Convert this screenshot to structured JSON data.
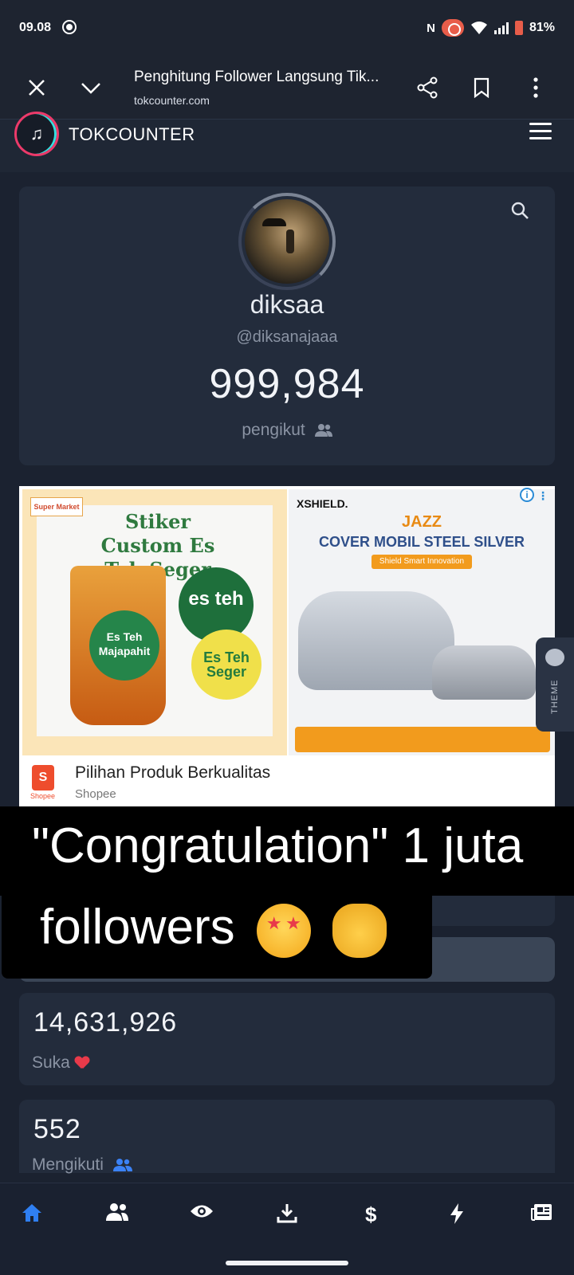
{
  "status_bar": {
    "time": "09.08",
    "battery": "81%",
    "nfc": "N"
  },
  "browser": {
    "title": "Penghitung Follower Langsung Tik...",
    "url": "tokcounter.com"
  },
  "site": {
    "name": "TOKCOUNTER"
  },
  "profile": {
    "display_name": "diksaa",
    "username": "@diksanajaaa",
    "followers": "999,984",
    "followers_label": "pengikut"
  },
  "ad": {
    "left": {
      "store_tag": "Super Market",
      "title": "Stiker Custom Es Teh Seger",
      "badge_1": "Es Teh Majapahit",
      "badge_2": "es teh",
      "badge_3": "Es Teh Seger"
    },
    "right": {
      "brand": "XSHIELD.",
      "model": "JAZZ",
      "headline": "COVER MOBIL STEEL SILVER",
      "tagline": "Shield Smart Innovation"
    },
    "headline": "Pilihan Produk Berkualitas",
    "source": "Shopee",
    "shopee_small": "Shopee",
    "info_glyph": "i",
    "menu_glyph": "⋮"
  },
  "theme_tab": {
    "label": "THEME"
  },
  "overlay": {
    "line1": "\"Congratulation\" 1 juta",
    "line2": "followers"
  },
  "stats": {
    "likes_value": "14,631,926",
    "likes_label": "Suka",
    "following_value": "552",
    "following_label": "Mengikuti"
  },
  "bottom_nav": {
    "items": [
      "home",
      "users",
      "eye",
      "download",
      "dollar",
      "bolt",
      "newspaper"
    ],
    "active": "home"
  },
  "colors": {
    "background": "#1b2230",
    "card": "#232c3c",
    "active_nav": "#2f7ff2",
    "heart": "#e83a4a",
    "users_icon": "#3b82f6"
  }
}
